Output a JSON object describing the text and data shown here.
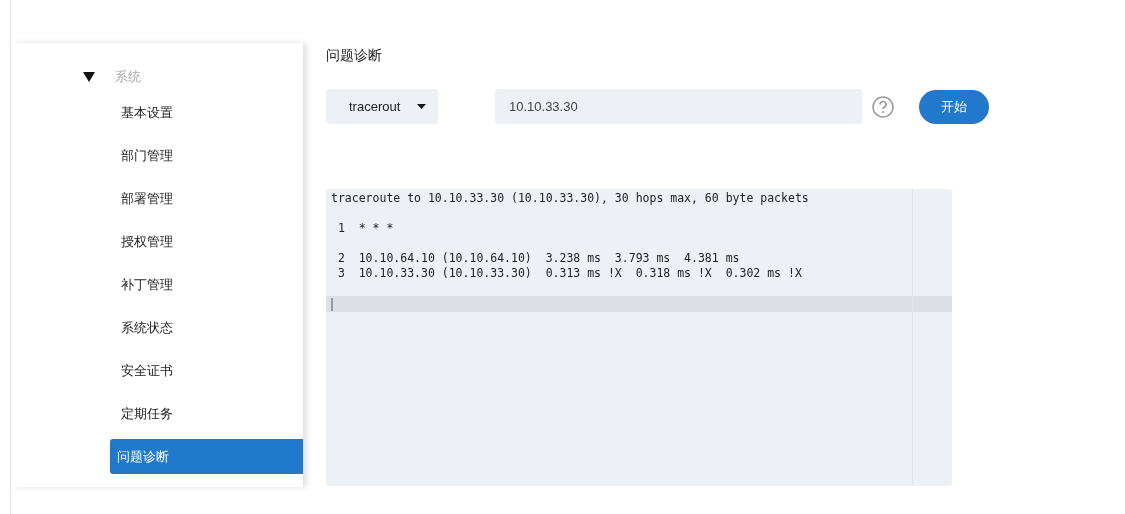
{
  "sidebar": {
    "group": {
      "label": "系统",
      "expanded": true
    },
    "items": [
      {
        "label": "基本设置",
        "selected": false
      },
      {
        "label": "部门管理",
        "selected": false
      },
      {
        "label": "部署管理",
        "selected": false
      },
      {
        "label": "授权管理",
        "selected": false
      },
      {
        "label": "补丁管理",
        "selected": false
      },
      {
        "label": "系统状态",
        "selected": false
      },
      {
        "label": "安全证书",
        "selected": false
      },
      {
        "label": "定期任务",
        "selected": false
      },
      {
        "label": "问题诊断",
        "selected": true
      }
    ]
  },
  "main": {
    "title": "问题诊断",
    "tool_select": "tracerout",
    "target_field": "10.10.33.30",
    "start_button": "开始",
    "output": "traceroute to 10.10.33.30 (10.10.33.30), 30 hops max, 60 byte packets\n\n 1  * * *\n\n 2  10.10.64.10 (10.10.64.10)  3.238 ms  3.793 ms  4.381 ms\n 3  10.10.33.30 (10.10.33.30)  0.313 ms !X  0.318 ms !X  0.302 ms !X\n"
  }
}
